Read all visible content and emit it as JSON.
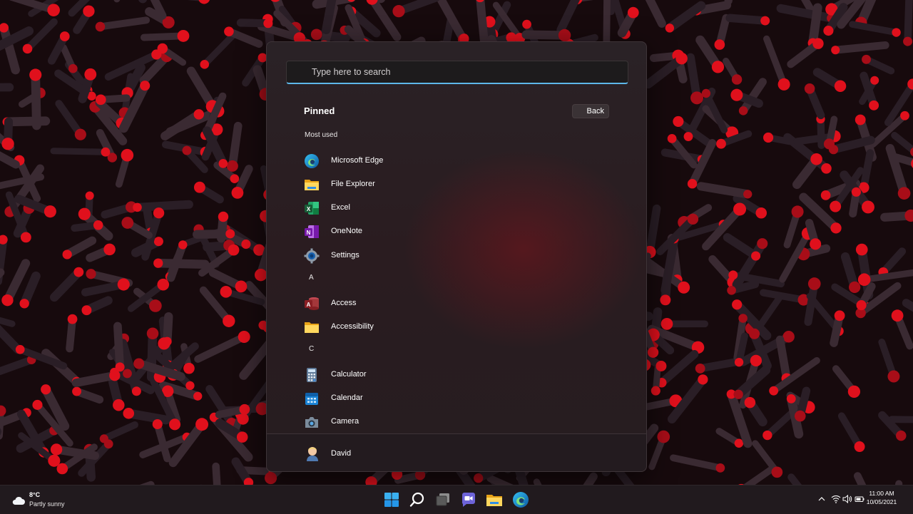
{
  "search": {
    "placeholder": "Type here to search"
  },
  "start_menu": {
    "pinned_title": "Pinned",
    "back_label": "Back",
    "most_used_label": "Most used",
    "most_used": [
      {
        "label": "Microsoft Edge",
        "icon": "edge-icon"
      },
      {
        "label": "File Explorer",
        "icon": "folder-icon"
      },
      {
        "label": "Excel",
        "icon": "excel-icon"
      },
      {
        "label": "OneNote",
        "icon": "onenote-icon"
      },
      {
        "label": "Settings",
        "icon": "gear-icon"
      }
    ],
    "group_a": "A",
    "apps_a": [
      {
        "label": "Access",
        "icon": "access-icon"
      },
      {
        "label": "Accessibility",
        "icon": "folder-icon"
      }
    ],
    "group_c": "C",
    "apps_c": [
      {
        "label": "Calculator",
        "icon": "calculator-icon"
      },
      {
        "label": "Calendar",
        "icon": "calendar-icon"
      },
      {
        "label": "Camera",
        "icon": "camera-icon"
      }
    ],
    "user_name": "David"
  },
  "taskbar": {
    "weather_temp": "8°C",
    "weather_condition": "Partly sunny",
    "time": "11:00 AM",
    "date": "10/05/2021",
    "apps": [
      "start-icon",
      "search-icon",
      "task-view-icon",
      "teams-chat-icon",
      "file-explorer-icon",
      "edge-icon"
    ]
  },
  "colors": {
    "accent": "#5db8ea",
    "wallpaper_red": "#e0101c"
  }
}
